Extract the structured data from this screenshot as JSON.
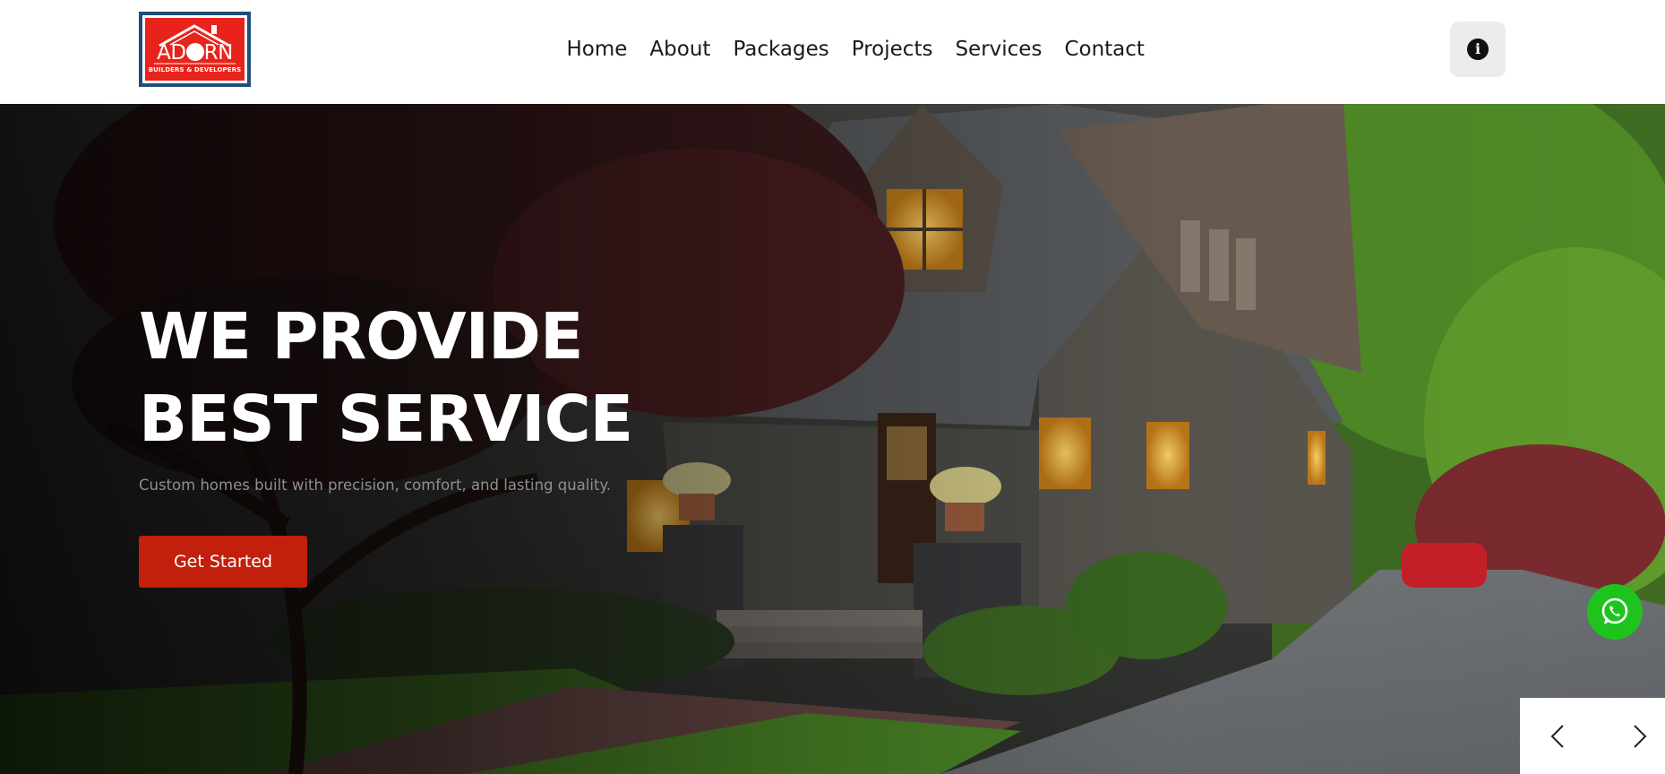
{
  "header": {
    "logo": {
      "word_before": "AD",
      "word_after": "RN",
      "tagline": "BUILDERS & DEVELOPERS",
      "colors": {
        "background": "#e8231b",
        "frame": "#1f4e79"
      }
    },
    "nav": [
      {
        "label": "Home"
      },
      {
        "label": "About"
      },
      {
        "label": "Packages"
      },
      {
        "label": "Projects"
      },
      {
        "label": "Services"
      },
      {
        "label": "Contact"
      }
    ],
    "info_button": {
      "icon": "info-circle-icon",
      "glyph": "i"
    }
  },
  "hero": {
    "title_line1": "WE PROVIDE",
    "title_line2": "BEST SERVICE",
    "subtitle": "Custom homes built with precision, comfort, and lasting quality.",
    "cta_label": "Get Started",
    "background": "photo of a craftsman-style house with trees and driveway at dusk",
    "colors": {
      "cta": "#c21f0c",
      "title": "#ffffff",
      "subtitle": "#8f8f8f"
    },
    "slider": {
      "prev_icon": "chevron-left-icon",
      "next_icon": "chevron-right-icon"
    }
  },
  "floating": {
    "whatsapp": {
      "icon": "whatsapp-icon",
      "color": "#1ec31e"
    }
  }
}
